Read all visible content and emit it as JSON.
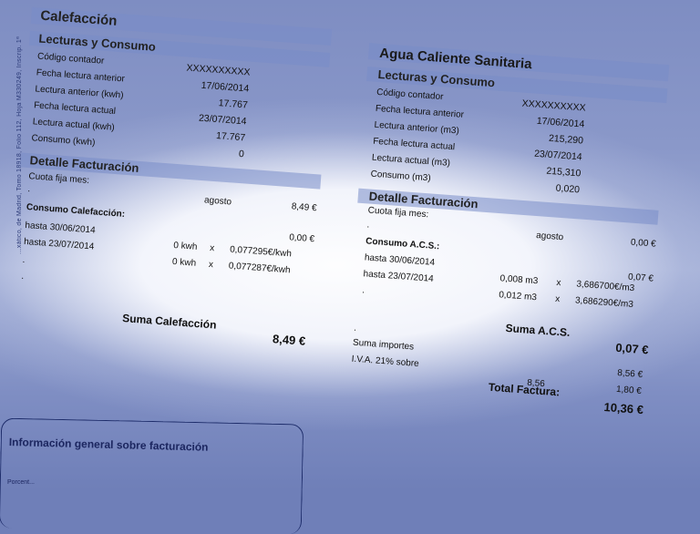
{
  "side_text": "...xático, de Madrid, Tomo 18918, Folio 112, Hoja M330249, Inscrip. 1ª",
  "calefaccion": {
    "title": "Calefacción",
    "lecturas_title": "Lecturas y Consumo",
    "rows": [
      {
        "label": "Código contador",
        "value": "XXXXXXXXXX"
      },
      {
        "label": "Fecha lectura anterior",
        "value": "17/06/2014"
      },
      {
        "label": "Lectura anterior (kwh)",
        "value": "17.767"
      },
      {
        "label": "Fecha lectura actual",
        "value": "23/07/2014"
      },
      {
        "label": "Lectura actual (kwh)",
        "value": "17.767"
      },
      {
        "label": "Consumo (kwh)",
        "value": "0"
      }
    ],
    "detalle_title": "Detalle Facturación",
    "cuota_label": "Cuota fija mes:",
    "cuota_month": "agosto",
    "cuota_amount": "8,49 €",
    "consumo_label": "Consumo Calefacción:",
    "consumo_amount": "0,00 €",
    "line1_label": "hasta 30/06/2014",
    "line1_qty": "0 kwh",
    "line1_x": "x",
    "line1_price": "0,077295€/kwh",
    "line2_label": "hasta 23/07/2014",
    "line2_qty": "0 kwh",
    "line2_x": "x",
    "line2_price": "0,077287€/kwh",
    "suma_label": "Suma Calefacción",
    "suma_amount": "8,49 €"
  },
  "acs": {
    "title": "Agua Caliente Sanitaria",
    "lecturas_title": "Lecturas y Consumo",
    "rows": [
      {
        "label": "Código contador",
        "value": "XXXXXXXXXX"
      },
      {
        "label": "Fecha lectura anterior",
        "value": "17/06/2014"
      },
      {
        "label": "Lectura anterior (m3)",
        "value": "215,290"
      },
      {
        "label": "Fecha lectura actual",
        "value": "23/07/2014"
      },
      {
        "label": "Lectura actual (m3)",
        "value": "215,310"
      },
      {
        "label": "Consumo (m3)",
        "value": "0,020"
      }
    ],
    "detalle_title": "Detalle Facturación",
    "cuota_label": "Cuota fija mes:",
    "cuota_month": "agosto",
    "cuota_amount": "0,00 €",
    "consumo_label": "Consumo A.C.S.:",
    "consumo_amount": "0,07 €",
    "line1_label": "hasta 30/06/2014",
    "line1_qty": "0,008 m3",
    "line1_x": "x",
    "line1_price": "3,686700€/m3",
    "line2_label": "hasta 23/07/2014",
    "line2_qty": "0,012 m3",
    "line2_x": "x",
    "line2_price": "3,686290€/m3",
    "suma_label": "Suma A.C.S.",
    "suma_amount": "0,07 €"
  },
  "totals": {
    "suma_importes_label": "Suma importes",
    "suma_importes_value": "8,56 €",
    "iva_label": "I.V.A. 21% sobre",
    "iva_base": "8,56",
    "iva_value": "1,80 €",
    "total_label": "Total Factura:",
    "total_value": "10,36 €"
  },
  "info": {
    "title": "Información general sobre facturación",
    "sub": "Porcent..."
  },
  "colors": {
    "background": "#6f7fb8",
    "band": "#8c9fd6"
  }
}
